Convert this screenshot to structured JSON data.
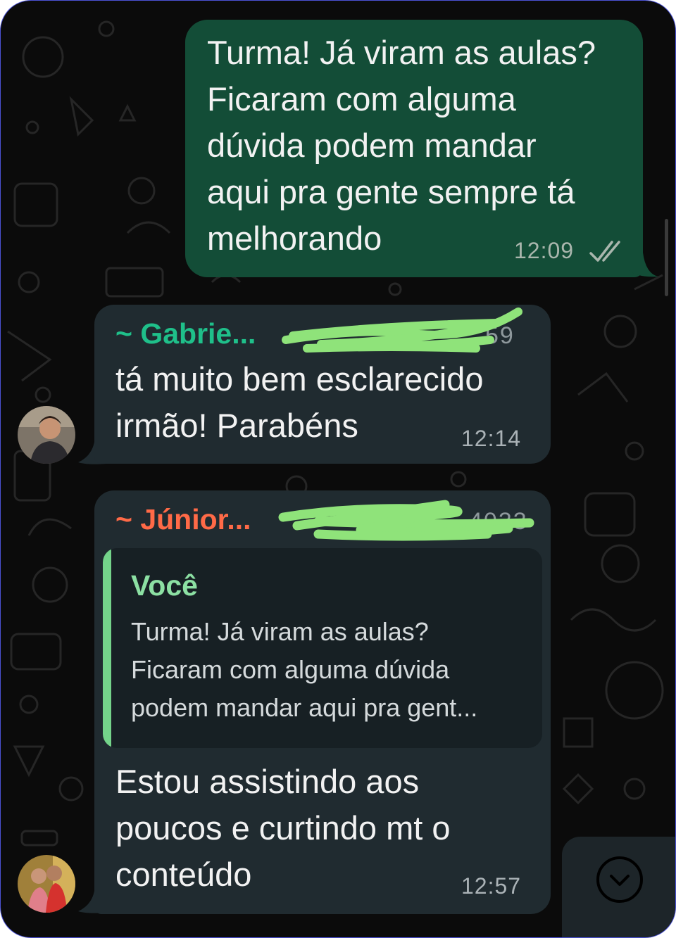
{
  "messages": [
    {
      "direction": "outgoing",
      "lines": [
        "Turma! Já viram as aulas?",
        "Ficaram com alguma",
        "dúvida podem mandar",
        "aqui pra gente sempre tá",
        "melhorando"
      ],
      "time": "12:09",
      "status_icon": "double-check-icon"
    },
    {
      "direction": "incoming",
      "sender": "~ Gabrie...",
      "sender_color": "#1fc08a",
      "phone_visible_suffix": "59",
      "lines": [
        "tá muito bem esclarecido",
        "irmão! Parabéns"
      ],
      "time": "12:14",
      "avatar": "avatar-photo"
    },
    {
      "direction": "incoming",
      "sender": "~ Júnior...",
      "sender_color": "#ff6a47",
      "phone_visible_suffix": "4033",
      "reply": {
        "author": "Você",
        "lines": [
          "Turma! Já viram as aulas?",
          "Ficaram com alguma dúvida",
          "podem mandar aqui pra gent..."
        ]
      },
      "lines": [
        "Estou assistindo aos",
        "poucos e curtindo mt o",
        "conteúdo"
      ],
      "time": "12:57",
      "avatar": "avatar-photo"
    }
  ],
  "scroll_button_icon": "chevron-down-icon",
  "colors": {
    "outgoing_bubble": "#134d37",
    "incoming_bubble": "#202b30",
    "redaction_scribble": "#8fe37a",
    "background": "#0b0b0b"
  }
}
